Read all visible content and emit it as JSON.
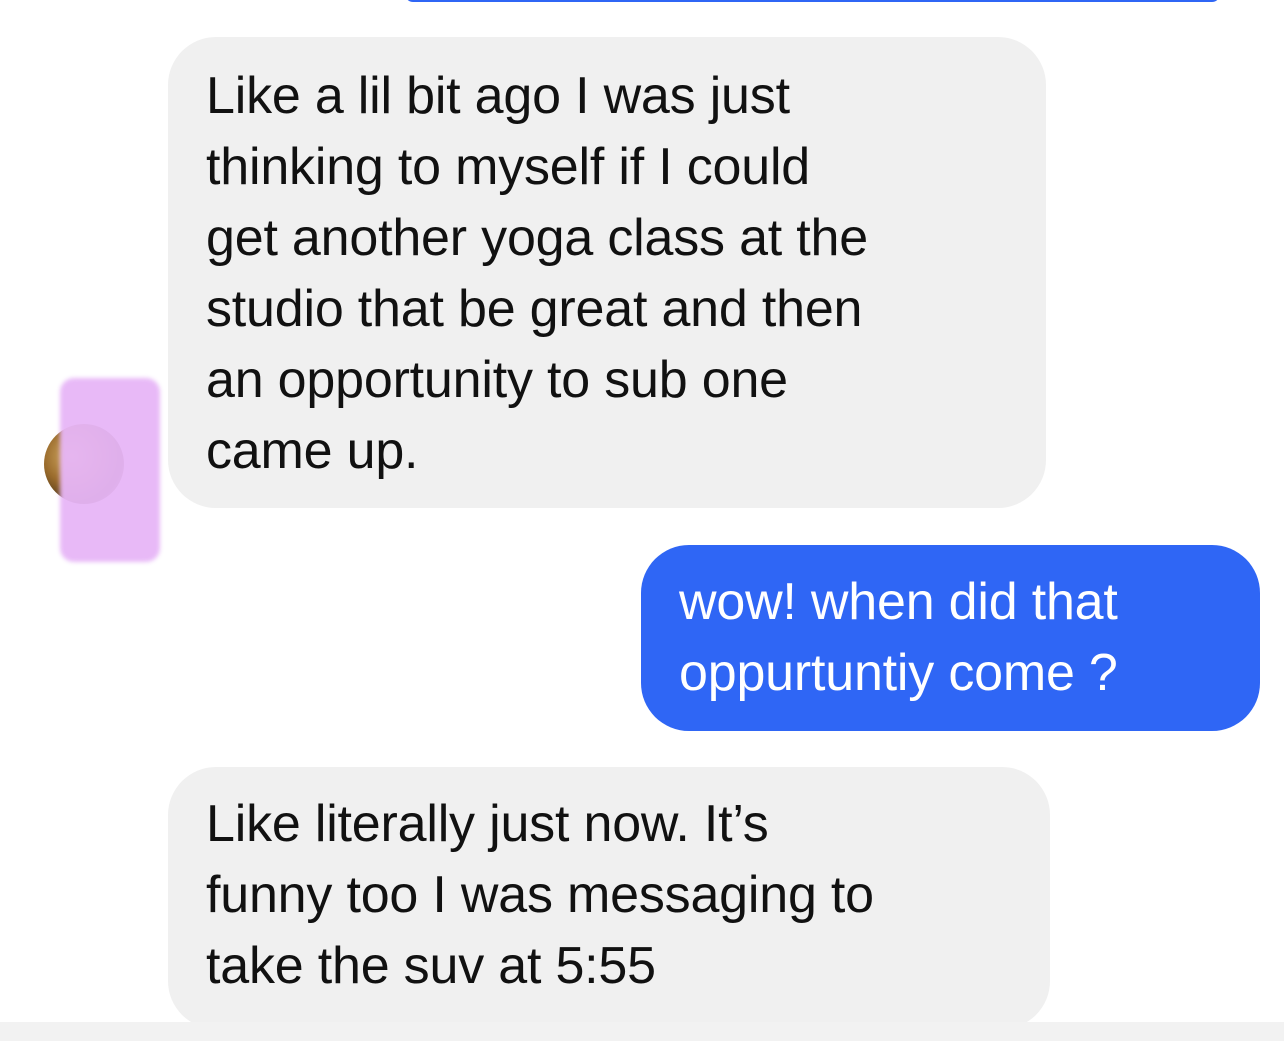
{
  "thread": {
    "messages": [
      {
        "sender": "contact",
        "text": "Like a lil bit ago I was just\nthinking to myself if I could\nget another yoga class at the\nstudio that be great and then\nan opportunity to sub one\ncame up."
      },
      {
        "sender": "me",
        "text": "wow! when did that\noppurtuntiy come ?"
      },
      {
        "sender": "contact",
        "text": "Like literally just now. It’s\nfunny too I was messaging to\ntake the suv at 5:55"
      }
    ]
  },
  "colors": {
    "incoming_bubble": "#f0f0f0",
    "outgoing_bubble": "#2f66f5",
    "incoming_text": "#111111",
    "outgoing_text": "#ffffff",
    "redaction": "#e7b6f7"
  },
  "icons": {
    "contact_avatar": "avatar-icon"
  }
}
